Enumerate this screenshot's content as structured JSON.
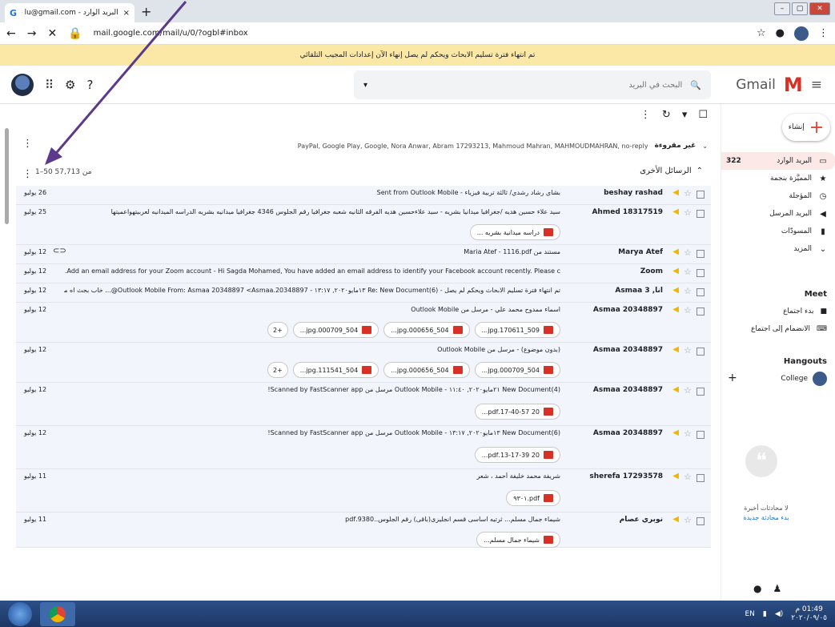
{
  "browser": {
    "tab_title": "البريد الوارد - Gmail - lu@gmail.com",
    "tab_close": "×",
    "new_tab": "+",
    "url": "mail.google.com/mail/u/0/?ogbl#inbox"
  },
  "notice": {
    "text": "تم انتهاء فترة تسليم الابحاث ويحكم لم يصل  إنهاء الآن  إعدادات المجيب التلقائي"
  },
  "header": {
    "app_name": "Gmail",
    "search_placeholder": "البحث في البريد"
  },
  "sidebar": {
    "compose_label": "إنشاء",
    "items": [
      {
        "label": "البريد الوارد",
        "count": "322",
        "icon": "inbox-icon"
      },
      {
        "label": "المميَّزة بنجمة",
        "count": "",
        "icon": "star-icon"
      },
      {
        "label": "المؤجلة",
        "count": "",
        "icon": "clock-icon"
      },
      {
        "label": "البريد المرسل",
        "count": "",
        "icon": "send-icon"
      },
      {
        "label": "المسودّات",
        "count": "",
        "icon": "draft-icon"
      },
      {
        "label": "المزيد",
        "count": "",
        "icon": "chevron-down-icon"
      }
    ],
    "meet_title": "Meet",
    "meet_new": "بدء اجتماع",
    "meet_join": "الانضمام إلى اجتماع",
    "hangouts_title": "Hangouts",
    "hangouts_user": "College",
    "no_chats": "لا محادثات أخيرة",
    "start_chat": "بدء محادثة جديدة"
  },
  "main": {
    "group_label": "غير مقروءة",
    "group_senders": "PayPal, Google Play, Google, Nora Anwar, Abram 17293213, Mahmoud Mahran, MAHMOUDMAHRAN, no-reply",
    "pager": "1–50 من 57,713",
    "other_title": "الرسائل الأخرى"
  },
  "rows": [
    {
      "sender": "beshay rashad",
      "subject": "بشاي رشاد رشدي/ ثالثة تربية فيزياء - Sent from Outlook Mobile",
      "date": "26 يوليو",
      "chips": []
    },
    {
      "sender": "Ahmed 18317519",
      "subject": "سيد علاء حسين هديه /جغرافيا ميدانيا بشريه - سيد علاءحسين هديه الفرقه الثانيه شعبه جغرافيا رقم الجلوس 4346 جغرافيا ميدانيه بشريه الدراسه الميدانيه لعربيتهواعميتها",
      "date": "25 يوليو",
      "chips": [
        "دراسه ميدانية بشريه ..."
      ]
    },
    {
      "sender": "Marya Atef",
      "subject": "مستند من Maria Atef - 1116.pdf",
      "date": "12 يوليو",
      "chips": []
    },
    {
      "sender": "Zoom",
      "subject": "Add an email address for your Zoom account - Hi Sagda Mohamed, You have added an email address to identify your Facebook account recently. Please c...",
      "date": "12 يوليو",
      "chips": []
    },
    {
      "sender": "Asmaa 3 ,أنا",
      "subject": "تم انتهاء فترة تسليم الابحاث ويحكم لم يصل - Re: New Document(6) ١٣مايو٢٠٢٠, ١٣:١٧ - Outlook Mobile From: Asmaa 20348897 <Asmaa.20348897@... خاب بحث اه مرسل من",
      "date": "12 يوليو",
      "chips": []
    },
    {
      "sender": "Asmaa 20348897",
      "subject": "اسماء ممدوح محمد علي - مرسل من Outlook Mobile",
      "date": "12 يوليو",
      "chips": [
        "509_170611.jpg...",
        "504_000656.jpg...",
        "504_000709.jpg..."
      ],
      "more": "+2"
    },
    {
      "sender": "Asmaa 20348897",
      "subject": "(بدون موضوع) - مرسل من Outlook Mobile",
      "date": "12 يوليو",
      "chips": [
        "504_000709.jpg...",
        "504_000656.jpg...",
        "504_111541.jpg..."
      ],
      "more": "+2"
    },
    {
      "sender": "Asmaa 20348897",
      "subject": "New Document(4) ٢١مايو٢٠٢٠, ١١:٤٠ - Outlook Mobile مرسل من Scanned by FastScanner app!",
      "date": "12 يوليو",
      "chips": [
        "20 17-40-57.pdf..."
      ]
    },
    {
      "sender": "Asmaa 20348897",
      "subject": "New Document(6) ١٣مايو٢٠٢٠, ١٣:١٧ - Outlook Mobile مرسل من Scanned by FastScanner app!",
      "date": "12 يوليو",
      "chips": [
        "20 13-17-39.pdf..."
      ]
    },
    {
      "sender": "sherefa 17293578",
      "subject": "شريفة محمد خليفة أحمد ، شعر",
      "date": "11 يوليو",
      "chips": [
        "pdf.٩٣٠١"
      ]
    },
    {
      "sender": "نوبري عصام",
      "subject": "شيماء جمال مسلم... ثرتيه اساسى قسم انجليزى(باقى) رقم الجلوس..9380.pdf",
      "date": "11 يوليو",
      "chips": [
        "شيماء جمال مسلم..."
      ]
    }
  ],
  "taskbar": {
    "lang": "EN",
    "time": "01:49 م",
    "date": "٢٠٢٠/٠٩/٠٥"
  }
}
